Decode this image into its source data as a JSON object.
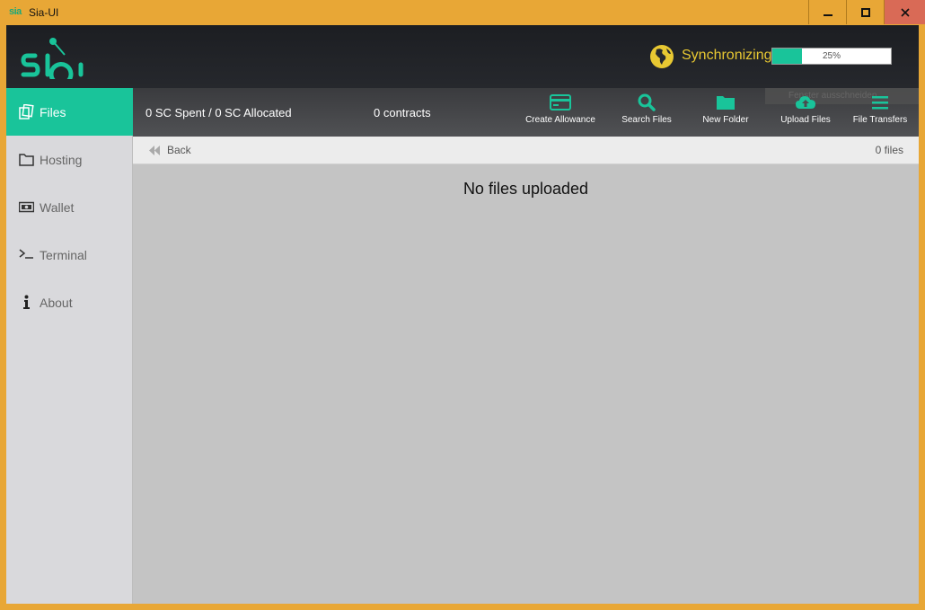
{
  "window": {
    "app_icon_text": "sia",
    "title": "Sia-UI",
    "minimize_symbol": "▁",
    "maximize_symbol": "□",
    "close_symbol": "✕"
  },
  "header": {
    "logo": "sia",
    "sync_status": "Synchronizing",
    "sync_progress_percent": 25,
    "sync_progress_label": "25%"
  },
  "sidebar": {
    "items": [
      {
        "label": "Files",
        "icon": "files-icon",
        "active": true
      },
      {
        "label": "Hosting",
        "icon": "folder-icon",
        "active": false
      },
      {
        "label": "Wallet",
        "icon": "wallet-icon",
        "active": false
      },
      {
        "label": "Terminal",
        "icon": "terminal-icon",
        "active": false
      },
      {
        "label": "About",
        "icon": "info-icon",
        "active": false
      }
    ]
  },
  "toolbar": {
    "spent_text": "0 SC Spent / 0 SC Allocated",
    "contracts_text": "0 contracts",
    "tooltip_text": "Fenster ausschneiden",
    "buttons": [
      {
        "label": "Create Allowance",
        "icon": "credit-card-icon"
      },
      {
        "label": "Search Files",
        "icon": "search-icon"
      },
      {
        "label": "New Folder",
        "icon": "folder-icon"
      },
      {
        "label": "Upload Files",
        "icon": "cloud-upload-icon"
      },
      {
        "label": "File Transfers",
        "icon": "menu-icon"
      }
    ]
  },
  "pathbar": {
    "back_label": "Back",
    "file_count": "0 files"
  },
  "content": {
    "empty_message": "No files uploaded"
  },
  "colors": {
    "accent": "#19c49a",
    "sync_yellow": "#e8c832",
    "window_border": "#e8a736"
  }
}
